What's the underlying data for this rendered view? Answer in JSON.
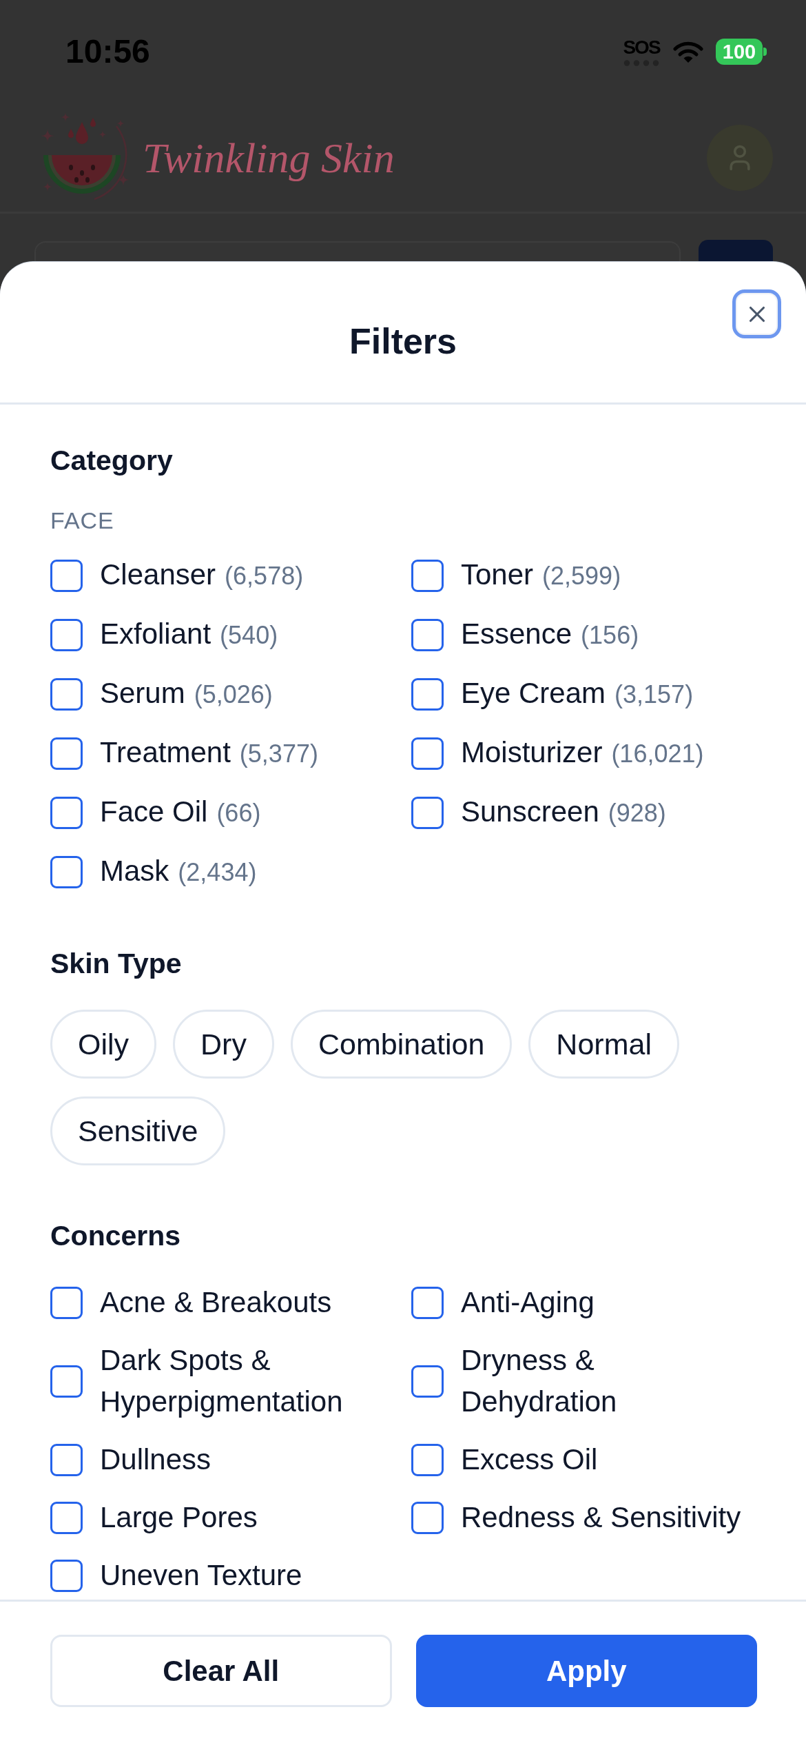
{
  "status_bar": {
    "time": "10:56",
    "signal_text": "SOS",
    "battery": "100"
  },
  "header": {
    "logo_text": "Twinkling Skin"
  },
  "filters": {
    "title": "Filters",
    "sections": [
      {
        "kind": "checkboxes",
        "title": "Category",
        "subheading": "FACE",
        "items": [
          {
            "label": "Cleanser",
            "count": "(6,578)",
            "checked": false
          },
          {
            "label": "Toner",
            "count": "(2,599)",
            "checked": false
          },
          {
            "label": "Exfoliant",
            "count": "(540)",
            "checked": false
          },
          {
            "label": "Essence",
            "count": "(156)",
            "checked": false
          },
          {
            "label": "Serum",
            "count": "(5,026)",
            "checked": false
          },
          {
            "label": "Eye Cream",
            "count": "(3,157)",
            "checked": false
          },
          {
            "label": "Treatment",
            "count": "(5,377)",
            "checked": false
          },
          {
            "label": "Moisturizer",
            "count": "(16,021)",
            "checked": false
          },
          {
            "label": "Face Oil",
            "count": "(66)",
            "checked": false
          },
          {
            "label": "Sunscreen",
            "count": "(928)",
            "checked": false
          },
          {
            "label": "Mask",
            "count": "(2,434)",
            "checked": false
          }
        ]
      },
      {
        "kind": "chips",
        "title": "Skin Type",
        "items": [
          {
            "label": "Oily",
            "selected": false
          },
          {
            "label": "Dry",
            "selected": false
          },
          {
            "label": "Combination",
            "selected": false
          },
          {
            "label": "Normal",
            "selected": false
          },
          {
            "label": "Sensitive",
            "selected": false
          }
        ]
      },
      {
        "kind": "checkboxes",
        "title": "Concerns",
        "items": [
          {
            "label": "Acne & Breakouts",
            "checked": false
          },
          {
            "label": "Anti-Aging",
            "checked": false
          },
          {
            "label": "Dark Spots & Hyperpigmentation",
            "checked": false
          },
          {
            "label": "Dryness & Dehydration",
            "checked": false
          },
          {
            "label": "Dullness",
            "checked": false
          },
          {
            "label": "Excess Oil",
            "checked": false
          },
          {
            "label": "Large Pores",
            "checked": false
          },
          {
            "label": "Redness & Sensitivity",
            "checked": false
          },
          {
            "label": "Uneven Texture",
            "checked": false
          }
        ]
      }
    ],
    "buttons": [
      {
        "kind": "secondary",
        "label": "Clear All"
      },
      {
        "kind": "primary",
        "label": "Apply"
      }
    ]
  }
}
